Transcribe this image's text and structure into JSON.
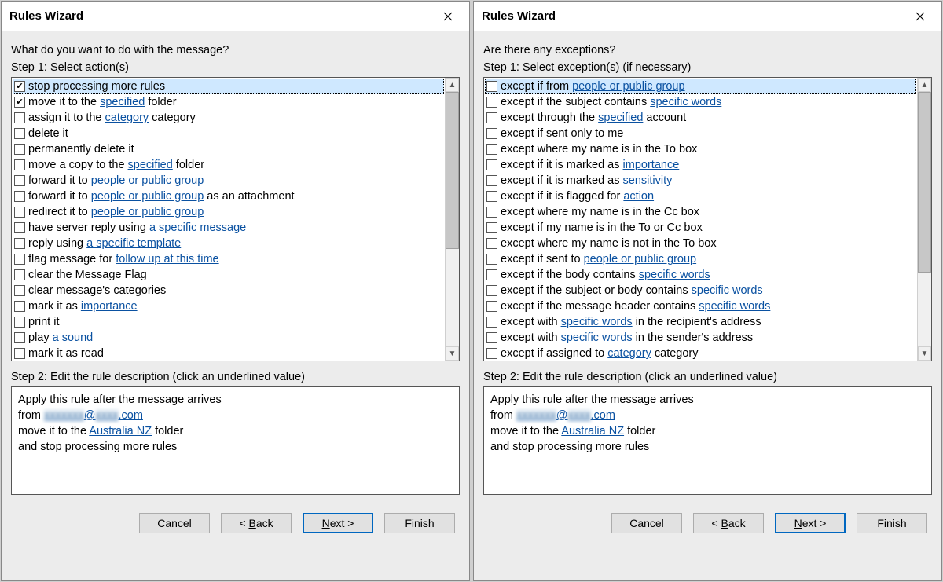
{
  "dialogs": [
    {
      "title": "Rules Wizard",
      "prompt": "What do you want to do with the message?",
      "step1_label": "Step 1: Select action(s)",
      "step2_label": "Step 2: Edit the rule description (click an underlined value)",
      "selected_index": 0,
      "items": [
        {
          "checked": true,
          "parts": [
            {
              "t": "stop processing more rules"
            }
          ]
        },
        {
          "checked": true,
          "parts": [
            {
              "t": "move it to the "
            },
            {
              "t": "specified",
              "link": true
            },
            {
              "t": " folder"
            }
          ]
        },
        {
          "checked": false,
          "parts": [
            {
              "t": "assign it to the "
            },
            {
              "t": "category",
              "link": true
            },
            {
              "t": " category"
            }
          ]
        },
        {
          "checked": false,
          "parts": [
            {
              "t": "delete it"
            }
          ]
        },
        {
          "checked": false,
          "parts": [
            {
              "t": "permanently delete it"
            }
          ]
        },
        {
          "checked": false,
          "parts": [
            {
              "t": "move a copy to the "
            },
            {
              "t": "specified",
              "link": true
            },
            {
              "t": " folder"
            }
          ]
        },
        {
          "checked": false,
          "parts": [
            {
              "t": "forward it to "
            },
            {
              "t": "people or public group",
              "link": true
            }
          ]
        },
        {
          "checked": false,
          "parts": [
            {
              "t": "forward it to "
            },
            {
              "t": "people or public group",
              "link": true
            },
            {
              "t": " as an attachment"
            }
          ]
        },
        {
          "checked": false,
          "parts": [
            {
              "t": "redirect it to "
            },
            {
              "t": "people or public group",
              "link": true
            }
          ]
        },
        {
          "checked": false,
          "parts": [
            {
              "t": "have server reply using "
            },
            {
              "t": "a specific message",
              "link": true
            }
          ]
        },
        {
          "checked": false,
          "parts": [
            {
              "t": "reply using "
            },
            {
              "t": "a specific template",
              "link": true
            }
          ]
        },
        {
          "checked": false,
          "parts": [
            {
              "t": "flag message for "
            },
            {
              "t": "follow up at this time",
              "link": true
            }
          ]
        },
        {
          "checked": false,
          "parts": [
            {
              "t": "clear the Message Flag"
            }
          ]
        },
        {
          "checked": false,
          "parts": [
            {
              "t": "clear message's categories"
            }
          ]
        },
        {
          "checked": false,
          "parts": [
            {
              "t": "mark it as "
            },
            {
              "t": "importance",
              "link": true
            }
          ]
        },
        {
          "checked": false,
          "parts": [
            {
              "t": "print it"
            }
          ]
        },
        {
          "checked": false,
          "parts": [
            {
              "t": "play "
            },
            {
              "t": "a sound",
              "link": true
            }
          ]
        },
        {
          "checked": false,
          "parts": [
            {
              "t": "mark it as read"
            }
          ]
        }
      ],
      "thumb_height": 200,
      "desc": {
        "line1": "Apply this rule after the message arrives",
        "from_prefix": "from ",
        "email_user": "xxxxxxx",
        "email_at": "@",
        "email_domain": "xxxx",
        "email_tld": ".com",
        "move_prefix": "move it to the ",
        "folder": "  Australia NZ",
        "move_suffix": " folder",
        "line4_indent": "  and stop processing more rules"
      },
      "buttons": {
        "cancel": "Cancel",
        "back_pre": "< ",
        "back_u": "B",
        "back_post": "ack",
        "next_u": "N",
        "next_post": "ext >",
        "finish": "Finish"
      }
    },
    {
      "title": "Rules Wizard",
      "prompt": "Are there any exceptions?",
      "step1_label": "Step 1: Select exception(s) (if necessary)",
      "step2_label": "Step 2: Edit the rule description (click an underlined value)",
      "selected_index": 0,
      "items": [
        {
          "checked": false,
          "parts": [
            {
              "t": "except if from "
            },
            {
              "t": "people or public group",
              "link": true
            }
          ]
        },
        {
          "checked": false,
          "parts": [
            {
              "t": "except if the subject contains "
            },
            {
              "t": "specific words",
              "link": true
            }
          ]
        },
        {
          "checked": false,
          "parts": [
            {
              "t": "except through the "
            },
            {
              "t": "specified",
              "link": true
            },
            {
              "t": " account"
            }
          ]
        },
        {
          "checked": false,
          "parts": [
            {
              "t": "except if sent only to me"
            }
          ]
        },
        {
          "checked": false,
          "parts": [
            {
              "t": "except where my name is in the To box"
            }
          ]
        },
        {
          "checked": false,
          "parts": [
            {
              "t": "except if it is marked as "
            },
            {
              "t": "importance",
              "link": true
            }
          ]
        },
        {
          "checked": false,
          "parts": [
            {
              "t": "except if it is marked as "
            },
            {
              "t": "sensitivity",
              "link": true
            }
          ]
        },
        {
          "checked": false,
          "parts": [
            {
              "t": "except if it is flagged for "
            },
            {
              "t": "action",
              "link": true
            }
          ]
        },
        {
          "checked": false,
          "parts": [
            {
              "t": "except where my name is in the Cc box"
            }
          ]
        },
        {
          "checked": false,
          "parts": [
            {
              "t": "except if my name is in the To or Cc box"
            }
          ]
        },
        {
          "checked": false,
          "parts": [
            {
              "t": "except where my name is not in the To box"
            }
          ]
        },
        {
          "checked": false,
          "parts": [
            {
              "t": "except if sent to "
            },
            {
              "t": "people or public group",
              "link": true
            }
          ]
        },
        {
          "checked": false,
          "parts": [
            {
              "t": "except if the body contains "
            },
            {
              "t": "specific words",
              "link": true
            }
          ]
        },
        {
          "checked": false,
          "parts": [
            {
              "t": "except if the subject or body contains "
            },
            {
              "t": "specific words",
              "link": true
            }
          ]
        },
        {
          "checked": false,
          "parts": [
            {
              "t": "except if the message header contains "
            },
            {
              "t": "specific words",
              "link": true
            }
          ]
        },
        {
          "checked": false,
          "parts": [
            {
              "t": "except with "
            },
            {
              "t": "specific words",
              "link": true
            },
            {
              "t": " in the recipient's address"
            }
          ]
        },
        {
          "checked": false,
          "parts": [
            {
              "t": "except with "
            },
            {
              "t": "specific words",
              "link": true
            },
            {
              "t": " in the sender's address"
            }
          ]
        },
        {
          "checked": false,
          "parts": [
            {
              "t": "except if assigned to "
            },
            {
              "t": "category",
              "link": true
            },
            {
              "t": " category"
            }
          ]
        }
      ],
      "thumb_height": 230,
      "desc": {
        "line1": "Apply this rule after the message arrives",
        "from_prefix": "from ",
        "email_user": "xxxxxxx",
        "email_at": "@",
        "email_domain": "xxxx",
        "email_tld": ".com",
        "move_prefix": "move it to the ",
        "folder": "  Australia NZ",
        "move_suffix": " folder",
        "line4_indent": "  and stop processing more rules"
      },
      "buttons": {
        "cancel": "Cancel",
        "back_pre": "< ",
        "back_u": "B",
        "back_post": "ack",
        "next_u": "N",
        "next_post": "ext >",
        "finish": "Finish"
      }
    }
  ]
}
